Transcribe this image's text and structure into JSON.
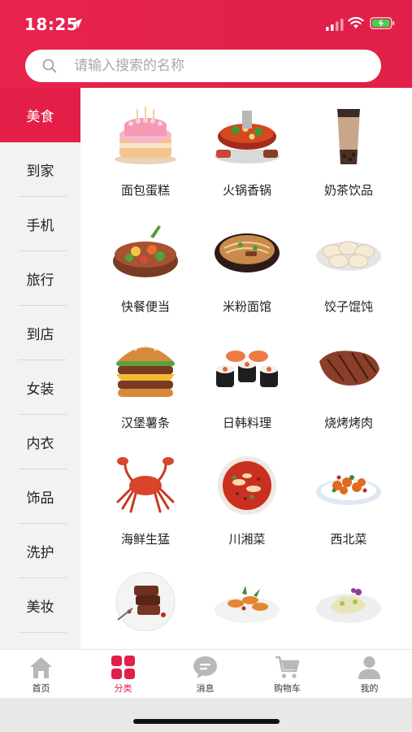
{
  "status_bar": {
    "time": "18:25"
  },
  "search": {
    "placeholder": "请输入搜索的名称"
  },
  "sidebar": {
    "items": [
      {
        "label": "美食",
        "active": true
      },
      {
        "label": "到家",
        "active": false
      },
      {
        "label": "手机",
        "active": false
      },
      {
        "label": "旅行",
        "active": false
      },
      {
        "label": "到店",
        "active": false
      },
      {
        "label": "女装",
        "active": false
      },
      {
        "label": "内衣",
        "active": false
      },
      {
        "label": "饰品",
        "active": false
      },
      {
        "label": "洗护",
        "active": false
      },
      {
        "label": "美妆",
        "active": false
      },
      {
        "label": "",
        "active": false
      }
    ]
  },
  "categories": [
    {
      "label": "面包蛋糕",
      "icon": "cake-icon"
    },
    {
      "label": "火锅香锅",
      "icon": "hotpot-icon"
    },
    {
      "label": "奶茶饮品",
      "icon": "milk-tea-icon"
    },
    {
      "label": "快餐便当",
      "icon": "bento-icon"
    },
    {
      "label": "米粉面馆",
      "icon": "noodle-bowl-icon"
    },
    {
      "label": "饺子馄饨",
      "icon": "dumplings-icon"
    },
    {
      "label": "汉堡薯条",
      "icon": "burger-icon"
    },
    {
      "label": "日韩料理",
      "icon": "sushi-icon"
    },
    {
      "label": "烧烤烤肉",
      "icon": "grilled-steak-icon"
    },
    {
      "label": "海鲜生猛",
      "icon": "crab-icon"
    },
    {
      "label": "川湘菜",
      "icon": "spicy-fish-icon"
    },
    {
      "label": "西北菜",
      "icon": "chicken-dish-icon"
    },
    {
      "label": "",
      "icon": "steak-plate-icon"
    },
    {
      "label": "",
      "icon": "shrimp-plate-icon"
    },
    {
      "label": "",
      "icon": "white-chicken-icon"
    }
  ],
  "tabbar": {
    "items": [
      {
        "label": "首页",
        "icon": "home-icon",
        "active": false
      },
      {
        "label": "分类",
        "icon": "category-grid-icon",
        "active": true
      },
      {
        "label": "消息",
        "icon": "message-icon",
        "active": false
      },
      {
        "label": "购物车",
        "icon": "cart-icon",
        "active": false
      },
      {
        "label": "我的",
        "icon": "user-icon",
        "active": false
      }
    ]
  },
  "colors": {
    "accent": "#e31e48",
    "sidebar_bg": "#f2f2f2",
    "tab_inactive": "#b8b8b8"
  }
}
